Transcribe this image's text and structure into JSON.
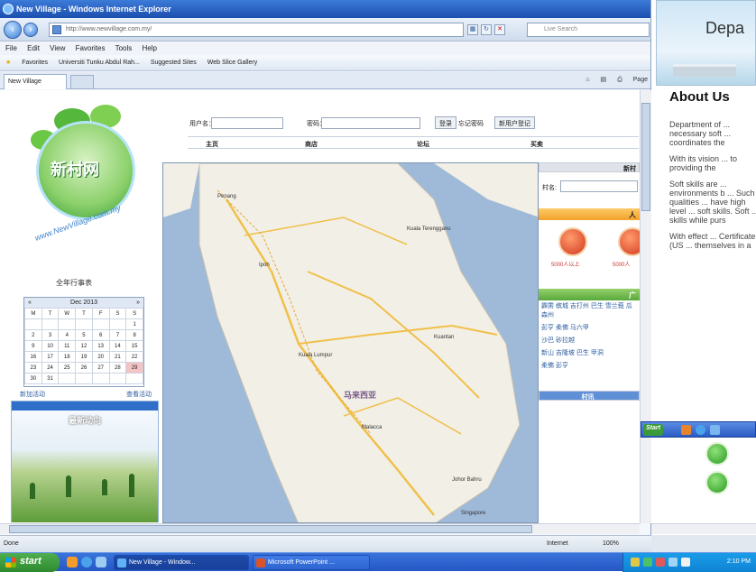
{
  "browser": {
    "title": "New Village - Windows Internet Explorer",
    "url": "http://www.newvillage.com.my/",
    "search_placeholder": "Live Search",
    "menu": [
      "File",
      "Edit",
      "View",
      "Favorites",
      "Tools",
      "Help"
    ],
    "favorites_label": "Favorites",
    "fav_links": [
      "Universiti Tunku Abdul Rah...",
      "Suggested Sites",
      "Web Slice Gallery"
    ],
    "tab_label": "New Village",
    "cmd": [
      "Page"
    ],
    "status_left": "Done",
    "status_zone": "Internet",
    "status_zoom": "100%"
  },
  "site": {
    "logo_text": "新村网",
    "logo_url": "www.NewVillage.com.my",
    "left_label": "全年行事表",
    "calendar": {
      "month": "Dec 2013",
      "prev": "«",
      "next": "»",
      "days": [
        "M",
        "T",
        "W",
        "T",
        "F",
        "S",
        "S"
      ],
      "weeks": [
        [
          "",
          "",
          "",
          "",
          "",
          "",
          "1"
        ],
        [
          "2",
          "3",
          "4",
          "5",
          "6",
          "7",
          "8"
        ],
        [
          "9",
          "10",
          "11",
          "12",
          "13",
          "14",
          "15"
        ],
        [
          "16",
          "17",
          "18",
          "19",
          "20",
          "21",
          "22"
        ],
        [
          "23",
          "24",
          "25",
          "26",
          "27",
          "28",
          "29"
        ],
        [
          "30",
          "31",
          "",
          "",
          "",
          "",
          ""
        ]
      ]
    },
    "cal_links": [
      "新加活动",
      "查看活动"
    ],
    "news_title": "最新动向",
    "login": {
      "user_label": "用户名：",
      "pass_label": "密码：",
      "login_btn": "登录",
      "forgot": "忘记密码",
      "register": "新用户登记"
    },
    "nav": [
      "主页",
      "商店",
      "论坛",
      "买卖"
    ],
    "map_labels": [
      "Penang",
      "Ipoh",
      "Kuala Terengganu",
      "Kuantan",
      "Kuala Lumpur",
      "Malacca",
      "Johor Bahru",
      "Singapore"
    ],
    "map_country": "马来西亚",
    "right": {
      "head1": "新村",
      "name_label": "村名:",
      "orange_bar": "人",
      "pop1": "5000人以上",
      "pop2": "5000人",
      "green_bar": "广",
      "tags": [
        "霹雳 槟城 吉打州 巴生 雪兰莪 瓜 森州",
        "彭亨 柔佛 马六甲",
        "沙巴 砂拉越",
        "新山 吉隆坡 巴生 甲洞",
        "柔佛 彭亨"
      ],
      "bottom_bar": "村讯"
    }
  },
  "ppt": {
    "banner_text": "Depa",
    "heading": "About Us",
    "paras": [
      "Department of ... necessary soft ... coordinates the",
      "With its vision ... to providing the",
      "Soft skills are ... environments b ... Such qualities ... have high level ... soft skills. Soft ... skills while purs",
      "With effect ... Certificate (US ... themselves in a"
    ]
  },
  "taskbar": {
    "start": "start",
    "buttons": [
      "New Village - Window...",
      "Microsoft PowerPoint ..."
    ],
    "mini_start": "Start",
    "clock": "2:10 PM"
  }
}
